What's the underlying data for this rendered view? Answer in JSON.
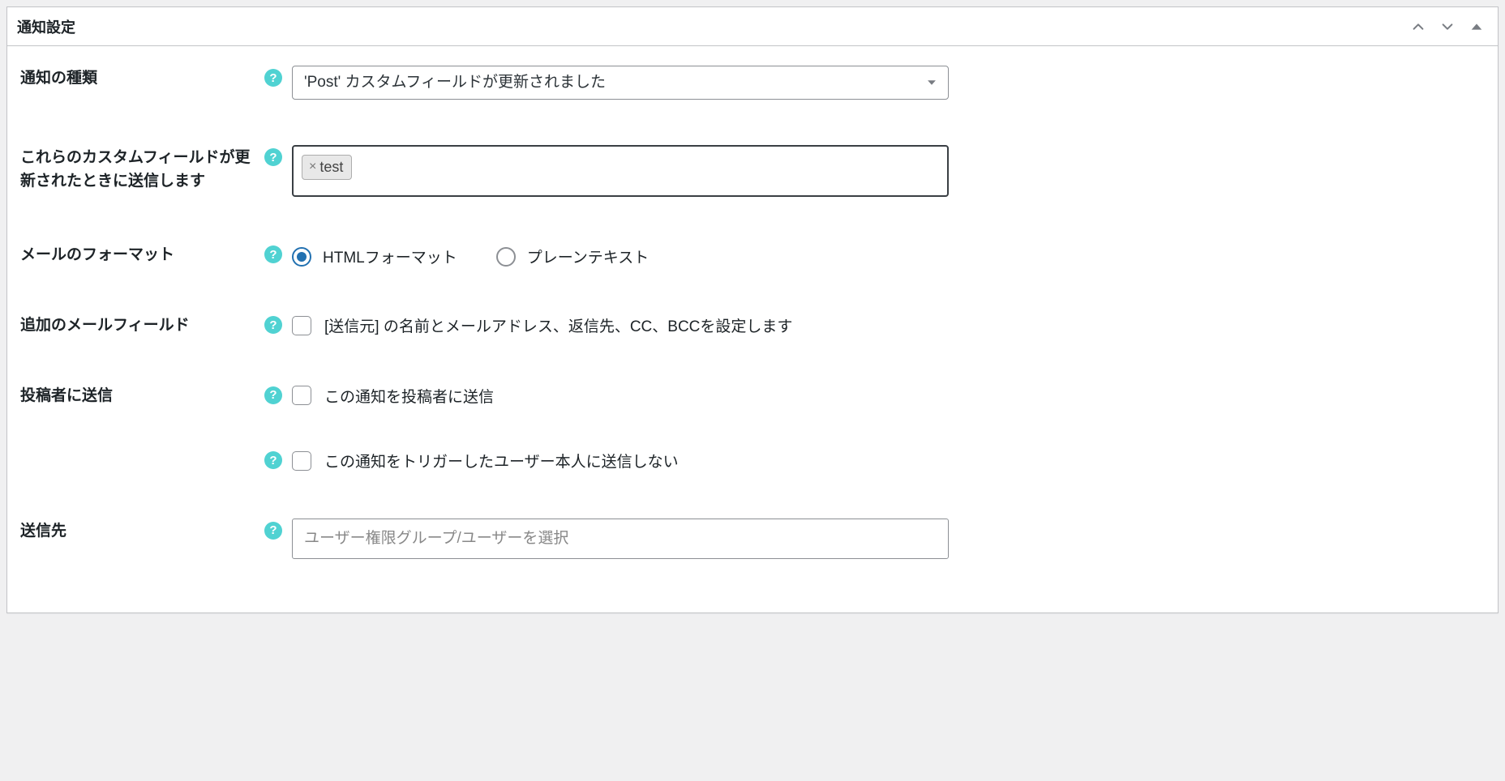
{
  "panel": {
    "title": "通知設定"
  },
  "fields": {
    "notification_type": {
      "label": "通知の種類",
      "value": "'Post' カスタムフィールドが更新されました"
    },
    "send_when_custom_fields_updated": {
      "label": "これらのカスタムフィールドが更新されたときに送信します",
      "tags": [
        "test"
      ]
    },
    "mail_format": {
      "label": "メールのフォーマット",
      "options": {
        "html": "HTMLフォーマット",
        "plain": "プレーンテキスト"
      },
      "selected": "html"
    },
    "additional_mail_fields": {
      "label": "追加のメールフィールド",
      "checkbox_label": "[送信元] の名前とメールアドレス、返信先、CC、BCCを設定します"
    },
    "send_to_author": {
      "label": "投稿者に送信",
      "checkbox_label": "この通知を投稿者に送信"
    },
    "skip_triggering_user": {
      "checkbox_label": "この通知をトリガーしたユーザー本人に送信しない"
    },
    "send_to": {
      "label": "送信先",
      "placeholder": "ユーザー権限グループ/ユーザーを選択"
    }
  }
}
